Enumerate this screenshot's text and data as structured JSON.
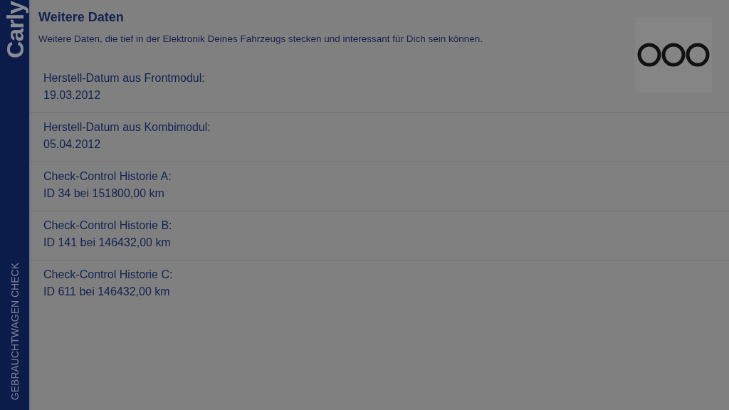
{
  "sidebar": {
    "logo": "Carly",
    "label": "GEBRAUCHTWAGEN CHECK"
  },
  "header": {
    "title": "Weitere Daten",
    "description": "Weitere Daten, die tief in der Elektronik Deines Fahrzeugs stecken und interessant für Dich sein können."
  },
  "items": [
    {
      "label": "Herstell-Datum aus Frontmodul:",
      "value": "19.03.2012"
    },
    {
      "label": "Herstell-Datum aus Kombimodul:",
      "value": "05.04.2012"
    },
    {
      "label": "Check-Control Historie A:",
      "value": "ID 34 bei 151800,00 km"
    },
    {
      "label": "Check-Control Historie B:",
      "value": "ID 141 bei 146432,00 km"
    },
    {
      "label": "Check-Control Historie C:",
      "value": "ID 611 bei 146432,00 km"
    }
  ]
}
